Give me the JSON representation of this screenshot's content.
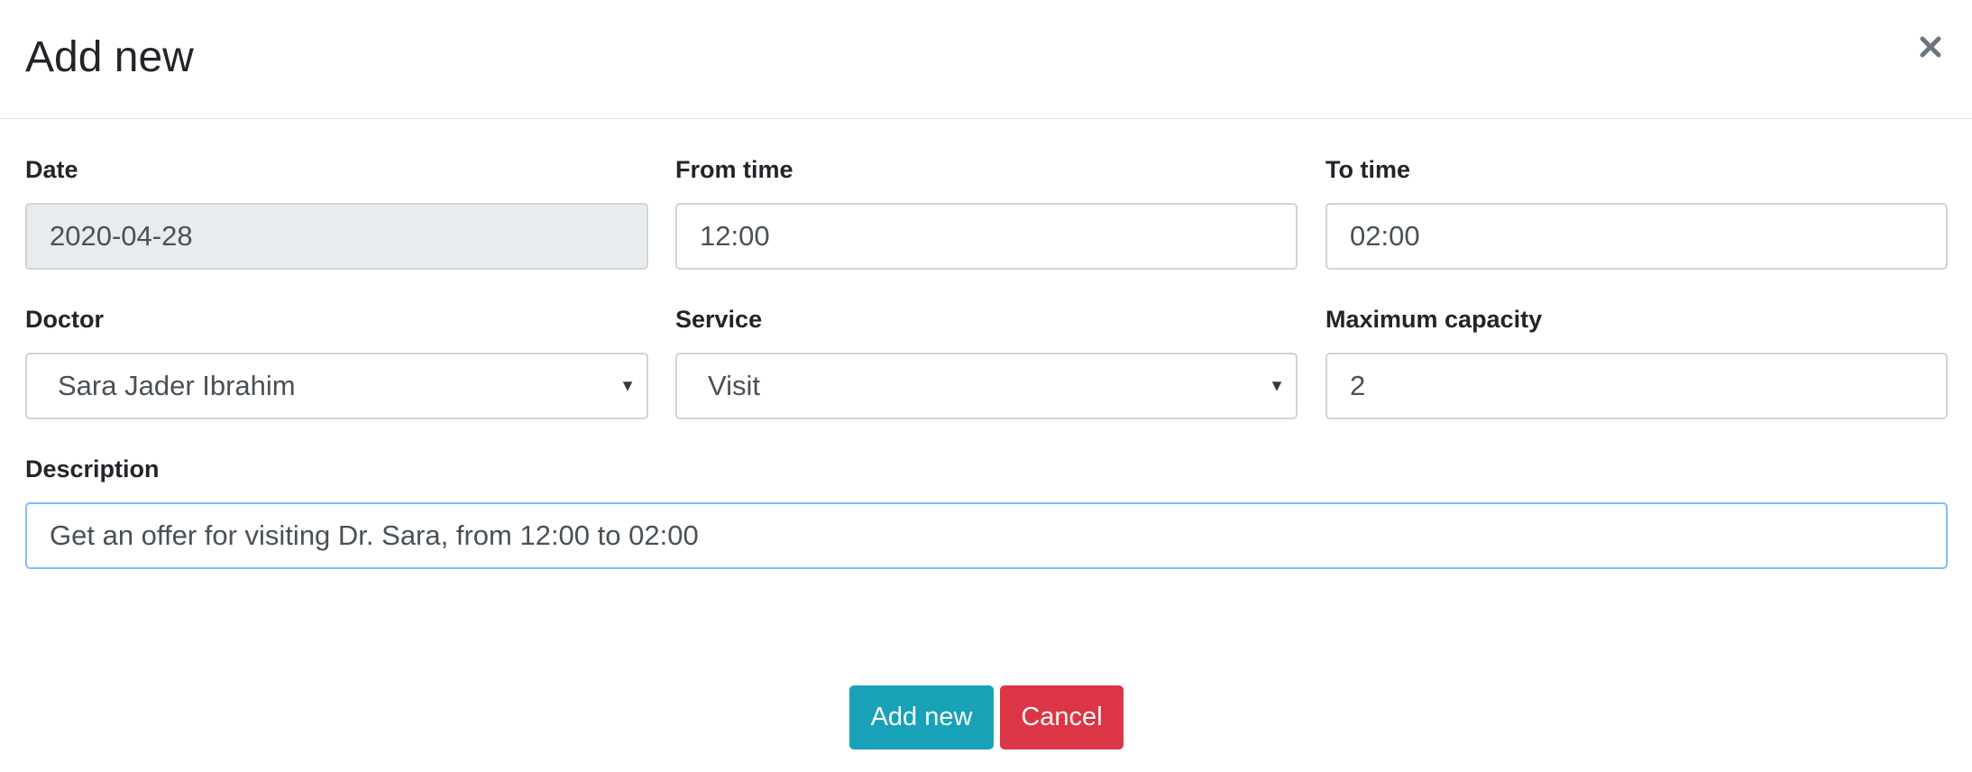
{
  "modal": {
    "title": "Add new",
    "close_symbol": "×"
  },
  "form": {
    "date": {
      "label": "Date",
      "value": "2020-04-28"
    },
    "from_time": {
      "label": "From time",
      "value": "12:00"
    },
    "to_time": {
      "label": "To time",
      "value": "02:00"
    },
    "doctor": {
      "label": "Doctor",
      "value": "Sara Jader Ibrahim"
    },
    "service": {
      "label": "Service",
      "value": "Visit"
    },
    "max_capacity": {
      "label": "Maximum capacity",
      "value": "2"
    },
    "description": {
      "label": "Description",
      "value": "Get an offer for visiting Dr. Sara, from 12:00 to 02:00"
    }
  },
  "footer": {
    "submit_label": "Add new",
    "cancel_label": "Cancel"
  },
  "colors": {
    "primary": "#17a2b8",
    "danger": "#dc3545",
    "readonly_bg": "#e9ecef",
    "focus_border": "#80bdff"
  },
  "icons": {
    "close": "close-icon",
    "select_caret": "caret-down-icon"
  }
}
